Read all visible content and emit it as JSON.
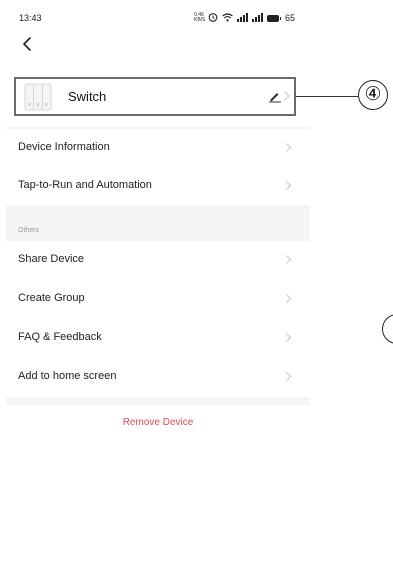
{
  "status_bar": {
    "time": "13:43",
    "speed_value": "0.46",
    "speed_unit": "KB/S",
    "battery_level": "65"
  },
  "device": {
    "name": "Switch"
  },
  "menu": {
    "device_information": "Device Information",
    "tap_to_run": "Tap-to-Run and Automation",
    "others_caption": "Others",
    "share_device": "Share Device",
    "create_group": "Create Group",
    "faq_feedback": "FAQ & Feedback",
    "add_to_home": "Add to home screen"
  },
  "remove_label": "Remove Device",
  "callout": {
    "number": "④"
  },
  "colors": {
    "remove_text": "#e5484d",
    "divider_band": "#f5f5f5",
    "card_border": "#6b6b6b"
  }
}
